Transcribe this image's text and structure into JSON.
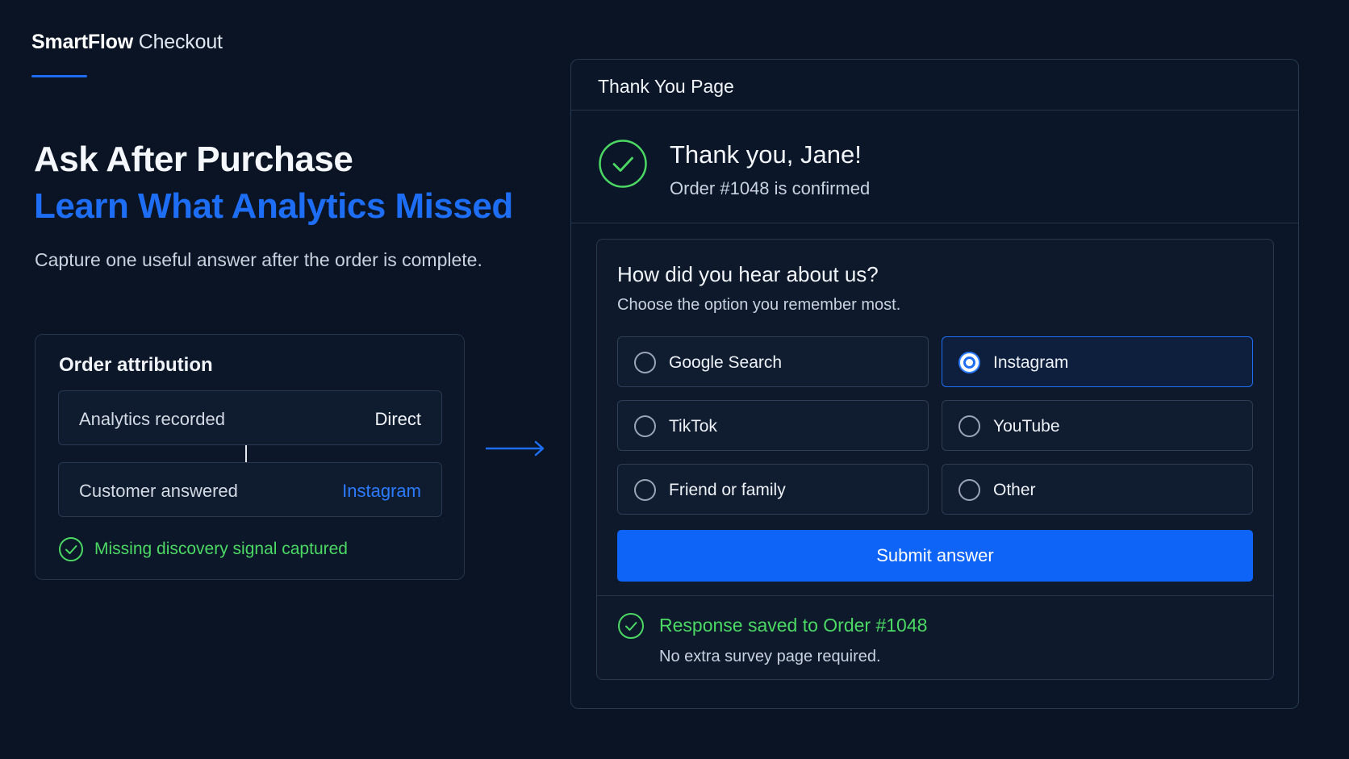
{
  "brand": {
    "name_bold": "SmartFlow",
    "name_light": "Checkout"
  },
  "hero": {
    "headline": "Ask After Purchase",
    "headline_accent": "Learn What Analytics Missed",
    "subheadline": "Capture one useful answer after the order is complete."
  },
  "attribution": {
    "title": "Order attribution",
    "rows": [
      {
        "label": "Analytics recorded",
        "value": "Direct"
      },
      {
        "label": "Customer answered",
        "value": "Instagram"
      }
    ],
    "signal": "Missing discovery signal captured"
  },
  "thank_you": {
    "panel_title": "Thank You Page",
    "greeting": "Thank you, Jane!",
    "order_status": "Order #1048 is confirmed",
    "survey": {
      "question": "How did you hear about us?",
      "hint": "Choose the option you remember most.",
      "options": [
        {
          "label": "Google Search",
          "selected": false
        },
        {
          "label": "Instagram",
          "selected": true
        },
        {
          "label": "TikTok",
          "selected": false
        },
        {
          "label": "YouTube",
          "selected": false
        },
        {
          "label": "Friend or family",
          "selected": false
        },
        {
          "label": "Other",
          "selected": false
        }
      ],
      "submit_label": "Submit answer",
      "saved_message": "Response saved to Order #1048",
      "saved_note": "No extra survey page required."
    }
  },
  "colors": {
    "background": "#0a1424",
    "accent_blue": "#1e6ef5",
    "success_green": "#4bd964"
  }
}
